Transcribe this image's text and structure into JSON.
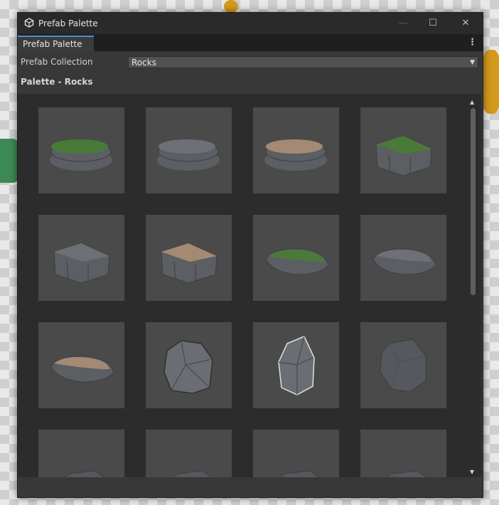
{
  "window": {
    "title": "Prefab Palette",
    "controls": {
      "minimize": "—",
      "maximize": "☐",
      "close": "✕"
    }
  },
  "tab": {
    "label": "Prefab Palette",
    "menu_icon": "⋮"
  },
  "collection": {
    "label": "Prefab Collection",
    "selected": "Rocks",
    "arrow": "▼"
  },
  "palette": {
    "title": "Palette - Rocks",
    "scroll_up": "▲",
    "scroll_down": "▼",
    "items": [
      {
        "icon": "flat-rock-grass-icon",
        "top": "#4a7a38",
        "body": "#5b5e63"
      },
      {
        "icon": "flat-rock-icon",
        "top": "#6d7177",
        "body": "#5b5e63"
      },
      {
        "icon": "flat-rock-sand-icon",
        "top": "#a48a73",
        "body": "#5b5e63"
      },
      {
        "icon": "cliff-rock-grass-icon",
        "top": "#4a7a38",
        "body": "#5b5e63"
      },
      {
        "icon": "cliff-rock-icon",
        "top": "#6d7177",
        "body": "#5b5e63"
      },
      {
        "icon": "cliff-rock-sand-icon",
        "top": "#a48a73",
        "body": "#5b5e63"
      },
      {
        "icon": "slab-rock-grass-icon",
        "top": "#4a7a38",
        "body": "#5b5e63"
      },
      {
        "icon": "slab-rock-icon",
        "top": "#6d7177",
        "body": "#5b5e63"
      },
      {
        "icon": "slab-rock-sand-icon",
        "top": "#a48a73",
        "body": "#5b5e63"
      },
      {
        "icon": "rock-cluster-icon",
        "top": "#6a6e72",
        "body": "#53575b"
      },
      {
        "icon": "crystal-rock-icon",
        "top": "#6a6e72",
        "body": "#53575b"
      },
      {
        "icon": "boulder-icon",
        "top": "#55595d",
        "body": "#46494d"
      },
      {
        "icon": "rock-partial-icon",
        "top": "#55595d",
        "body": "#46494d"
      },
      {
        "icon": "rock-partial-icon",
        "top": "#55595d",
        "body": "#46494d"
      },
      {
        "icon": "rock-partial-icon",
        "top": "#55595d",
        "body": "#46494d"
      },
      {
        "icon": "rock-partial-icon",
        "top": "#55595d",
        "body": "#46494d"
      }
    ]
  }
}
